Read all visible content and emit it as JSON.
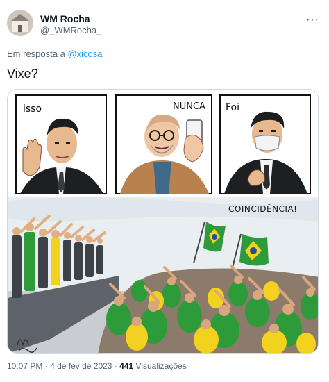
{
  "tweet": {
    "display_name": "WM Rocha",
    "handle": "@_WMRocha_",
    "reply_prefix": "Em resposta a",
    "reply_to": "@xicosa",
    "text": "Vixe?",
    "time": "10:07 PM",
    "date": "4 de fev de 2023",
    "separator": "·",
    "views_count": "441",
    "views_label": "Visualizações"
  },
  "cartoon": {
    "panel_1_caption": "isso",
    "panel_2_caption": "NUNCA",
    "panel_3_caption": "Foi",
    "bottom_caption": "COINCIDÊNCIA!",
    "signature": "Marco Motta"
  },
  "icons": {
    "more": "more-dots-icon"
  },
  "colors": {
    "link": "#1d9bf0",
    "secondary_text": "#536471",
    "flag_green": "#2e9b3a",
    "flag_yellow": "#f2d21f"
  }
}
